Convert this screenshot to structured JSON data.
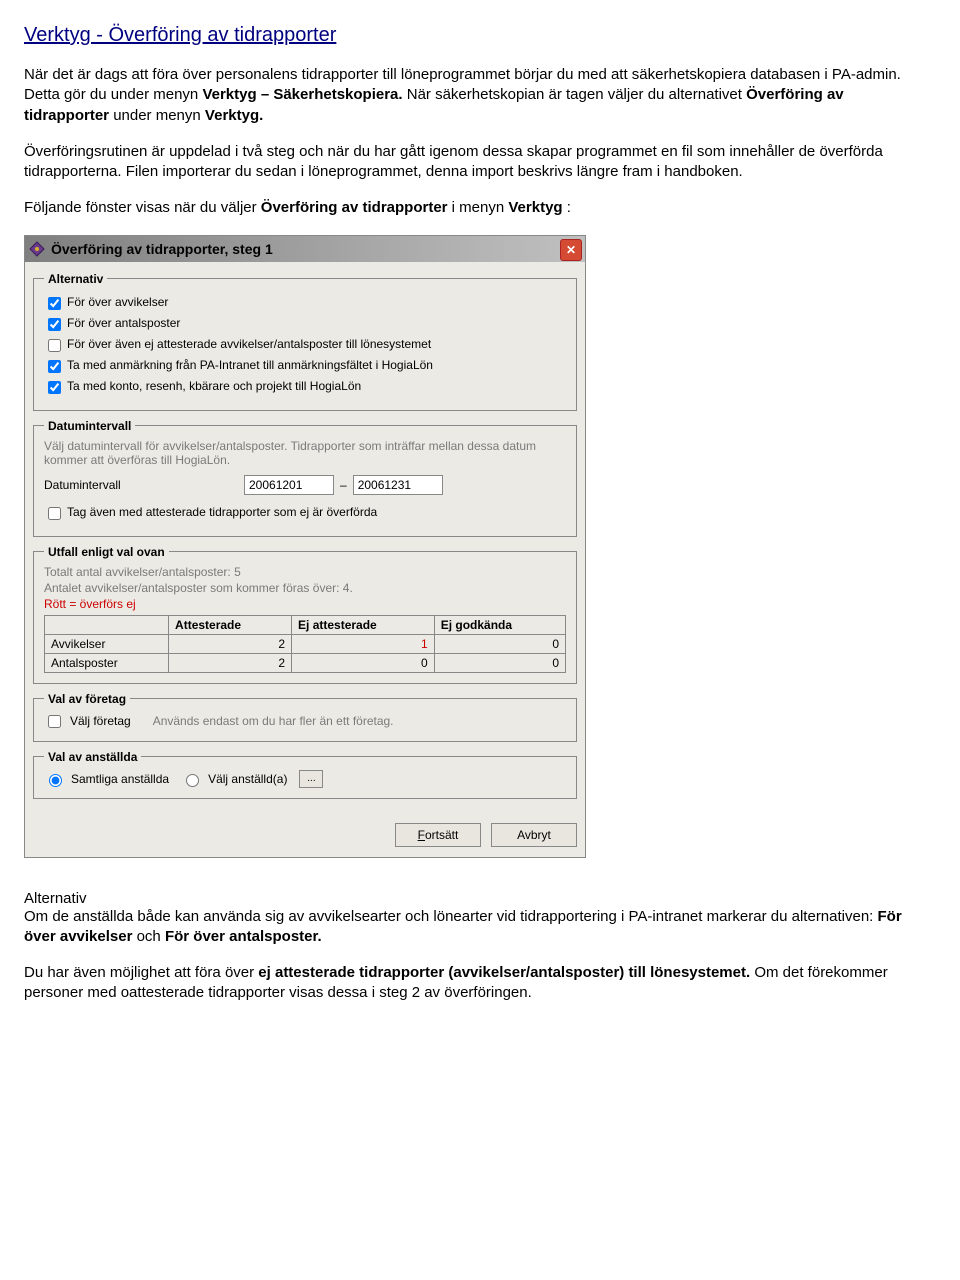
{
  "doc": {
    "title": "Verktyg - Överföring av tidrapporter",
    "para1a": "När det är dags att föra över personalens tidrapporter till löneprogrammet börjar du med att säkerhetskopiera databasen i PA-admin. Detta gör du under menyn ",
    "para1b": "Verktyg – Säkerhetskopiera.",
    "para1c": " När säkerhetskopian är tagen väljer du alternativet ",
    "para1d": "Överföring av tidrapporter",
    "para1e": " under menyn ",
    "para1f": "Verktyg.",
    "para2": "Överföringsrutinen är uppdelad i två steg och när du har gått igenom dessa skapar programmet en fil som innehåller de överförda tidrapporterna. Filen importerar du sedan i löneprogrammet, denna import beskrivs längre fram i handboken.",
    "para3a": "Följande fönster visas när du väljer ",
    "para3b": "Överföring av tidrapporter",
    "para3c": " i menyn ",
    "para3d": "Verktyg",
    "para3e": ":",
    "after_heading": "Alternativ",
    "after_p1a": "Om de anställda både kan använda sig av avvikelsearter och lönearter vid tidrapportering i PA-intranet markerar du alternativen: ",
    "after_p1b": "För över avvikelser",
    "after_p1c": " och ",
    "after_p1d": "För över antalsposter.",
    "after_p2a": "Du har även möjlighet att föra över ",
    "after_p2b": "ej attesterade tidrapporter (avvikelser/antalsposter) till lönesystemet.",
    "after_p2c": " Om det förekommer personer med oattesterade tidrapporter visas dessa i steg 2 av överföringen."
  },
  "dialog": {
    "title": "Överföring av tidrapporter, steg 1",
    "alt_legend": "Alternativ",
    "alt_items": [
      "För över avvikelser",
      "För över antalsposter",
      "För över även ej attesterade avvikelser/antalsposter till lönesystemet",
      "Ta med anmärkning från PA-Intranet till anmärkningsfältet i HogiaLön",
      "Ta med konto, resenh, kbärare och projekt till HogiaLön"
    ],
    "date_legend": "Datumintervall",
    "date_help": "Välj datumintervall för avvikelser/antalsposter. Tidrapporter som inträffar mellan dessa datum kommer att överföras till HogiaLön.",
    "date_label": "Datumintervall",
    "date_from": "20061201",
    "date_to": "20061231",
    "date_extra": "Tag även med attesterade tidrapporter som ej är överförda",
    "utfall_legend": "Utfall enligt val ovan",
    "utfall_total": "Totalt antal avvikelser/antalsposter: 5",
    "utfall_count": "Antalet avvikelser/antalsposter som kommer föras över: 4.",
    "utfall_red": "Rött = överförs ej",
    "table": {
      "headers": [
        "",
        "Attesterade",
        "Ej attesterade",
        "Ej godkända"
      ],
      "rows": [
        {
          "label": "Avvikelser",
          "a": "2",
          "b": "1",
          "c": "0",
          "b_red": true
        },
        {
          "label": "Antalsposter",
          "a": "2",
          "b": "0",
          "c": "0",
          "b_red": false
        }
      ]
    },
    "foretag_legend": "Val av företag",
    "foretag_chk": "Välj företag",
    "foretag_help": "Används endast om du har fler än ett företag.",
    "anst_legend": "Val av anställda",
    "anst_all": "Samtliga anställda",
    "anst_sel": "Välj anställd(a)",
    "browse": "...",
    "btn_continue": "Fortsätt",
    "btn_cancel": "Avbryt"
  }
}
